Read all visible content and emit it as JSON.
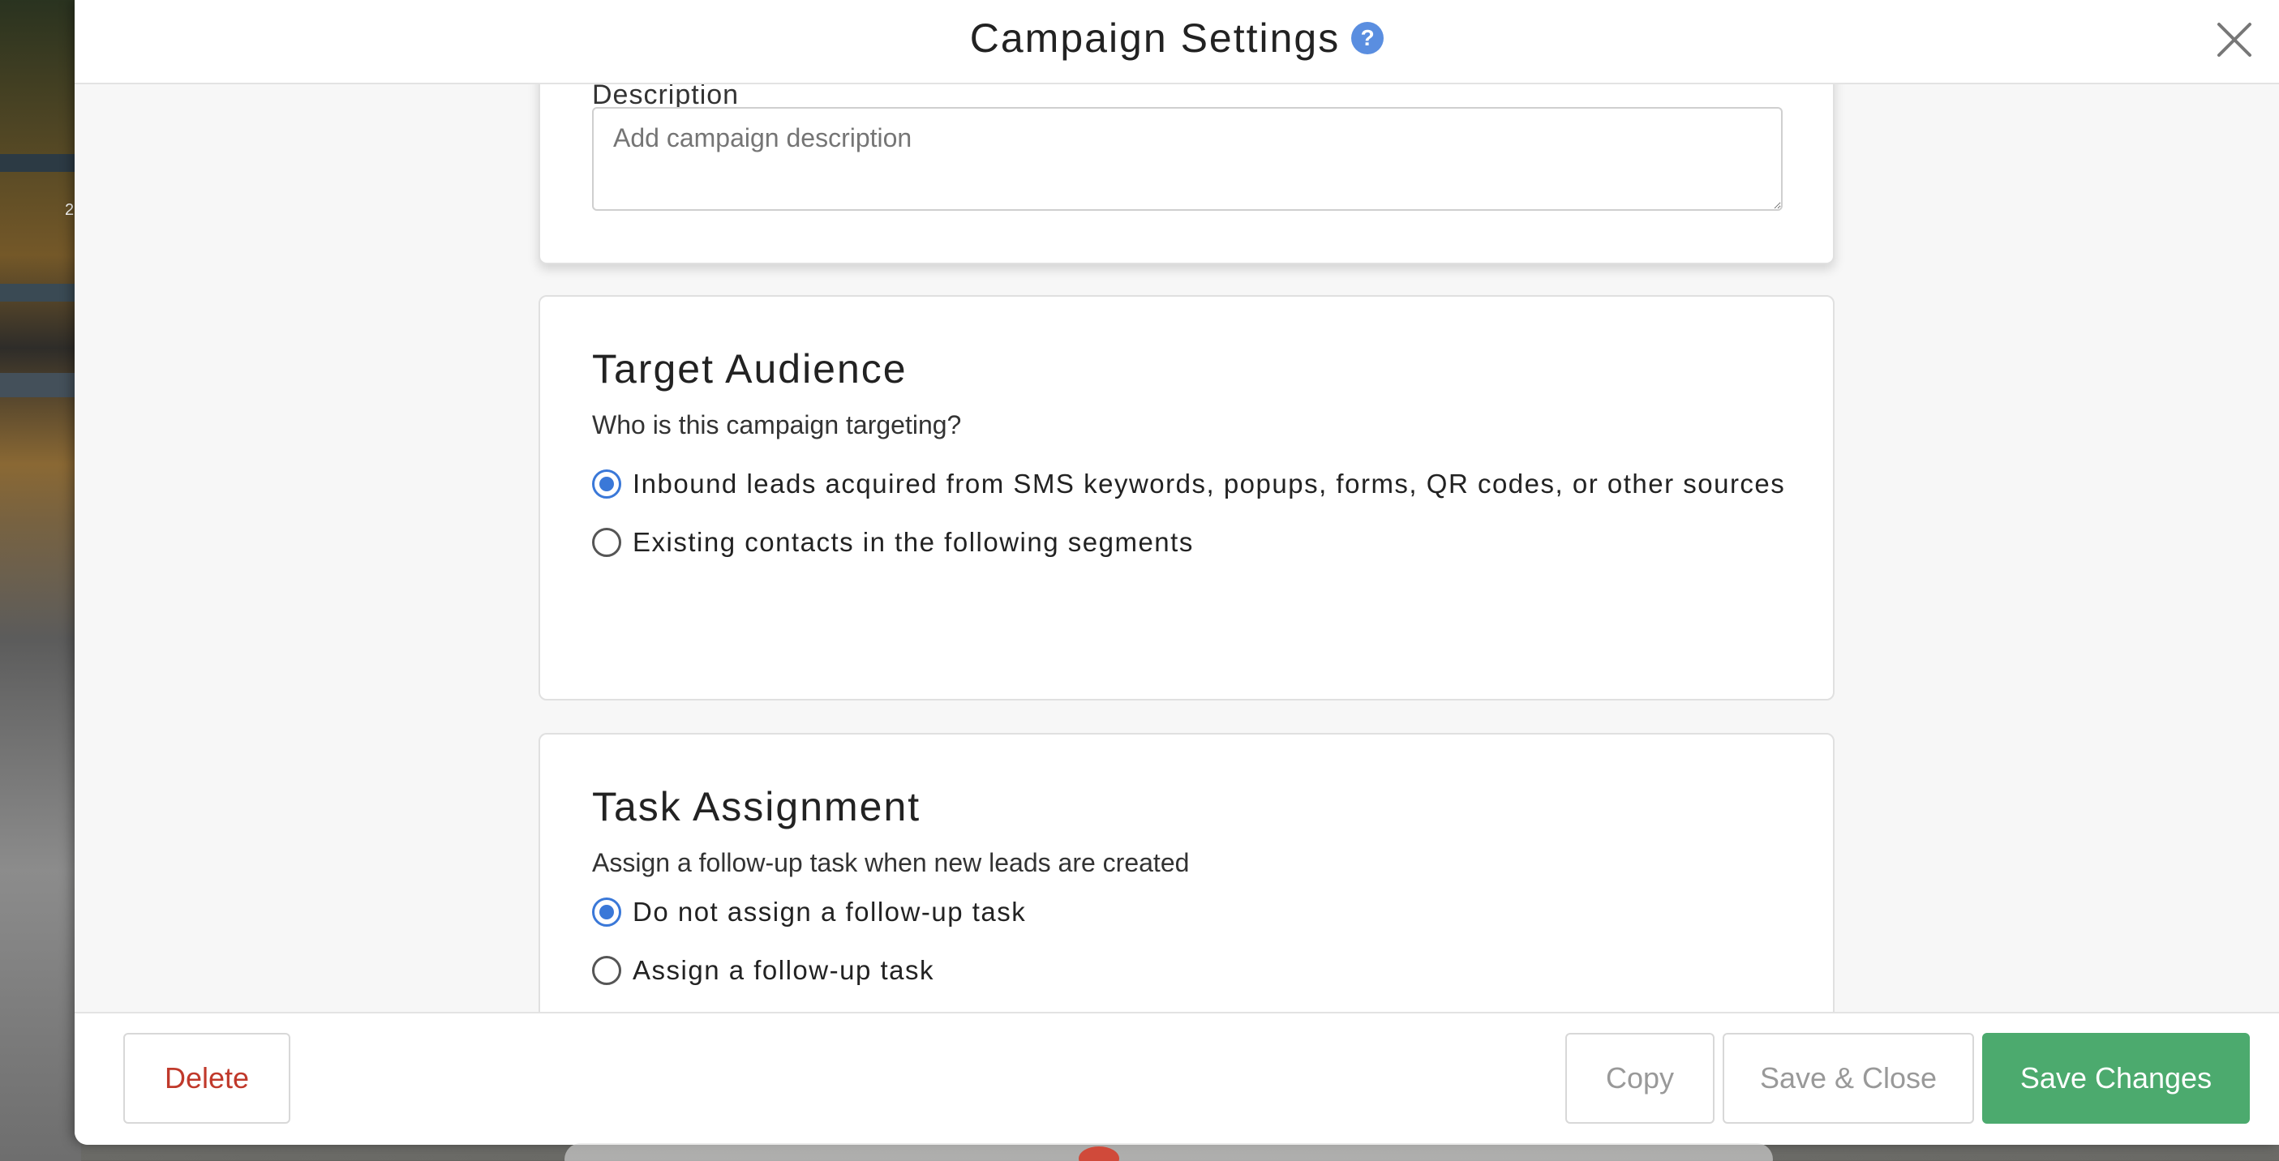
{
  "modal": {
    "title": "Campaign Settings",
    "help_icon_glyph": "?"
  },
  "background": {
    "tag_text": "2"
  },
  "description": {
    "label": "Description",
    "placeholder": "Add campaign description"
  },
  "target_audience": {
    "title": "Target Audience",
    "subtitle": "Who is this campaign targeting?",
    "options": [
      {
        "label": "Inbound leads acquired from SMS keywords, popups, forms, QR codes, or other sources",
        "selected": true
      },
      {
        "label": "Existing contacts in the following segments",
        "selected": false
      }
    ]
  },
  "task_assignment": {
    "title": "Task Assignment",
    "subtitle": "Assign a follow-up task when new leads are created",
    "options": [
      {
        "label": "Do not assign a follow-up task",
        "selected": true
      },
      {
        "label": "Assign a follow-up task",
        "selected": false
      }
    ]
  },
  "footer": {
    "delete_label": "Delete",
    "copy_label": "Copy",
    "save_close_label": "Save & Close",
    "save_changes_label": "Save Changes"
  },
  "colors": {
    "accent_blue": "#3a78d8",
    "save_green": "#4caa6e",
    "delete_red": "#c0392b"
  }
}
